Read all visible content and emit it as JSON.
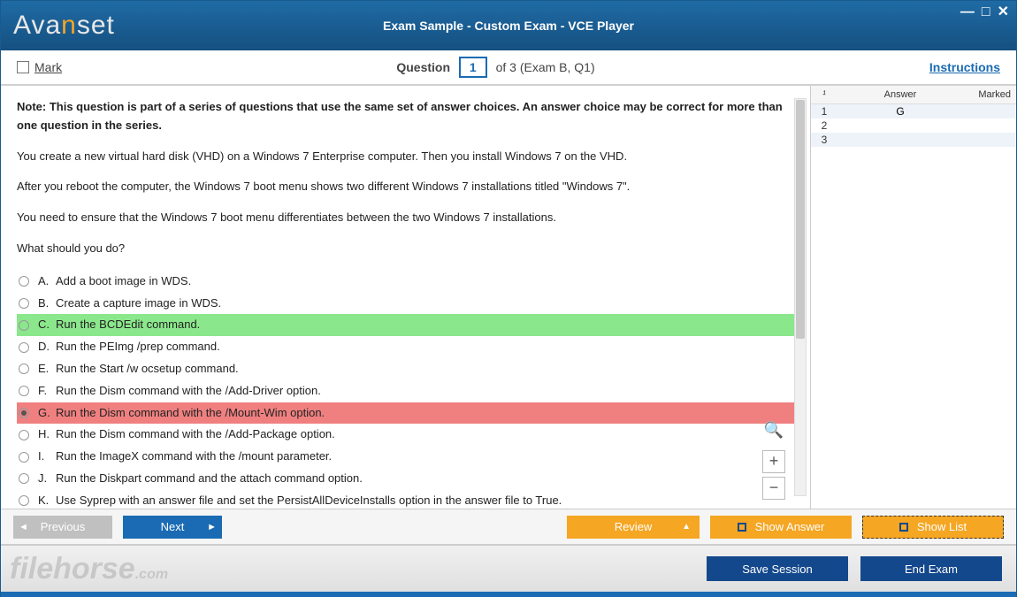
{
  "titlebar": {
    "logo_a": "Ava",
    "logo_n": "n",
    "logo_b": "set",
    "title": "Exam Sample - Custom Exam - VCE Player"
  },
  "qbar": {
    "mark": "Mark",
    "question_word": "Question",
    "qnum": "1",
    "of_text": "of 3 (Exam B, Q1)",
    "instructions": "Instructions"
  },
  "question": {
    "note": "Note: This question is part of a series of questions that use the same set of answer choices. An answer choice may be correct for more than one question in the series.",
    "p1": "You create a new virtual hard disk (VHD) on a Windows 7 Enterprise computer. Then you install Windows 7 on the VHD.",
    "p2": "After you reboot the computer, the Windows 7 boot menu shows two different Windows 7 installations titled \"Windows 7\".",
    "p3": "You need to ensure that the Windows 7 boot menu differentiates between the two Windows 7 installations.",
    "p4": "What should you do?",
    "answers": [
      {
        "letter": "A.",
        "text": "Add a boot image in WDS.",
        "state": ""
      },
      {
        "letter": "B.",
        "text": "Create a capture image in WDS.",
        "state": ""
      },
      {
        "letter": "C.",
        "text": "Run the BCDEdit command.",
        "state": "green"
      },
      {
        "letter": "D.",
        "text": "Run the PEImg /prep command.",
        "state": ""
      },
      {
        "letter": "E.",
        "text": "Run the Start /w ocsetup command.",
        "state": ""
      },
      {
        "letter": "F.",
        "text": "Run the Dism command with the /Add-Driver option.",
        "state": ""
      },
      {
        "letter": "G.",
        "text": "Run the Dism command with the /Mount-Wim option.",
        "state": "red"
      },
      {
        "letter": "H.",
        "text": "Run the Dism command with the /Add-Package option.",
        "state": ""
      },
      {
        "letter": "I.",
        "text": "Run the ImageX command with the /mount parameter.",
        "state": ""
      },
      {
        "letter": "J.",
        "text": "Run the Diskpart command and the attach command option.",
        "state": ""
      },
      {
        "letter": "K.",
        "text": "Use Syprep with an answer file and set the PersistAllDeviceInstalls option in the answer file to True.",
        "state": ""
      }
    ]
  },
  "side": {
    "h_num": "¹",
    "h_answer": "Answer",
    "h_marked": "Marked",
    "rows": [
      {
        "n": "1",
        "ans": "G"
      },
      {
        "n": "2",
        "ans": ""
      },
      {
        "n": "3",
        "ans": ""
      }
    ]
  },
  "buttons": {
    "previous": "Previous",
    "next": "Next",
    "review": "Review",
    "show_answer": "Show Answer",
    "show_list": "Show List"
  },
  "footer": {
    "save": "Save Session",
    "end": "End Exam",
    "watermark_a": "filehorse",
    "watermark_b": ".com"
  }
}
